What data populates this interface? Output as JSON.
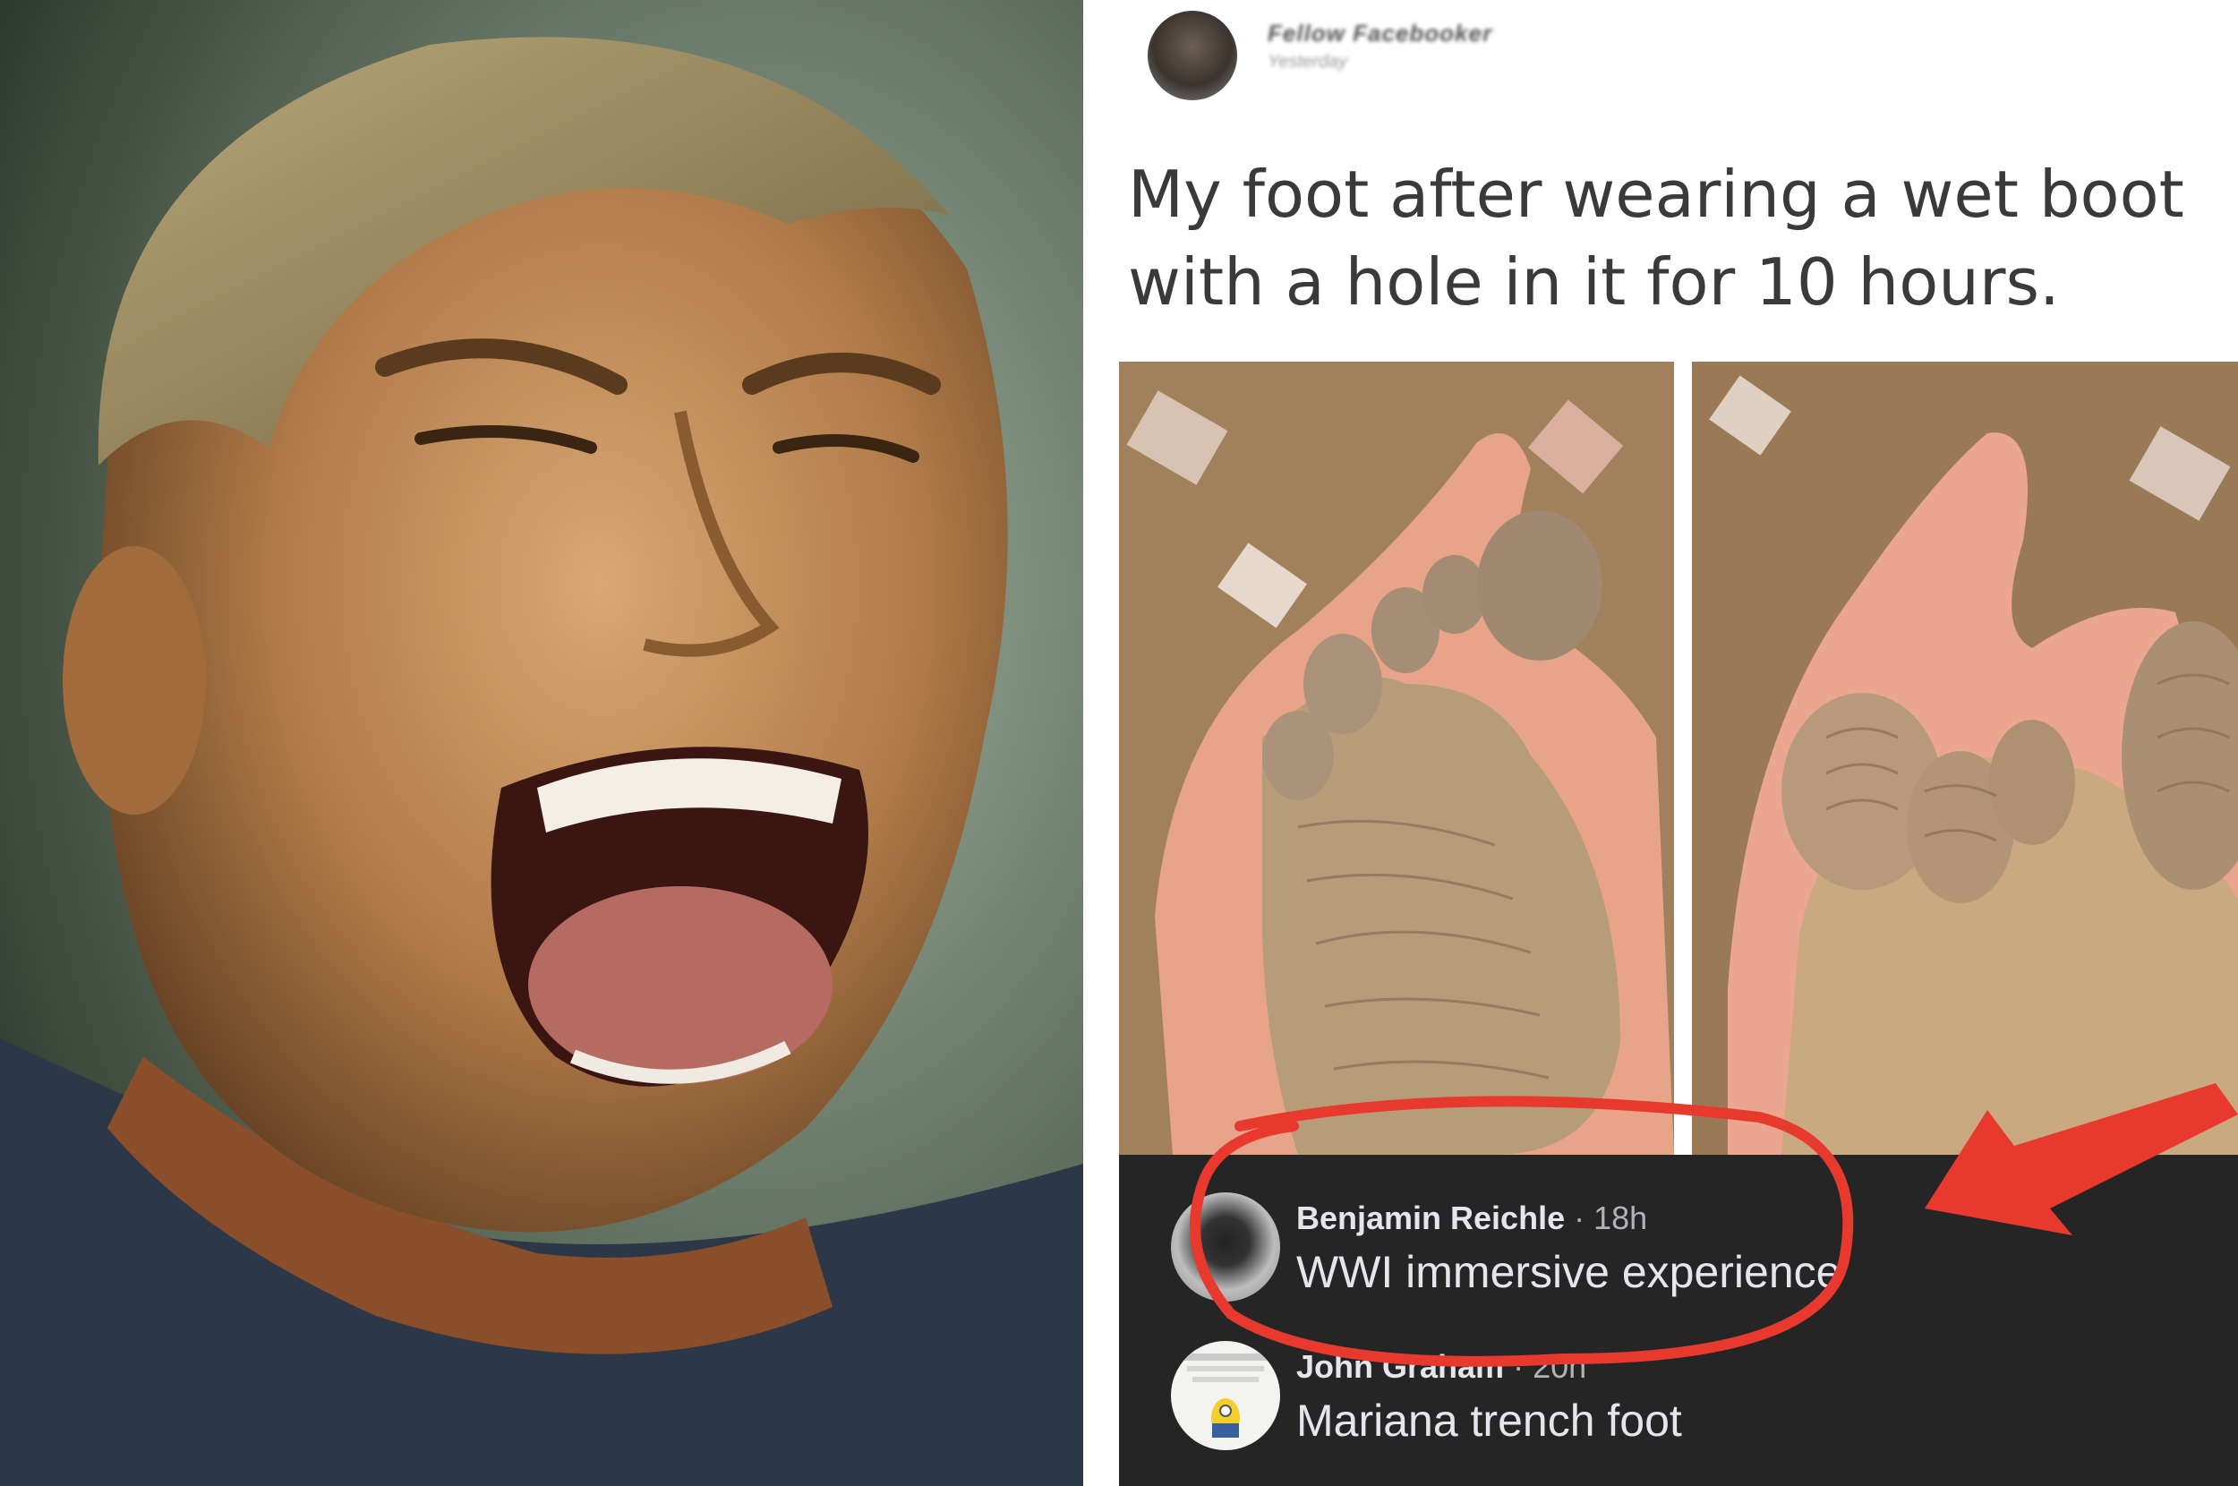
{
  "left_image": {
    "description_icon": "laughing-man-photo"
  },
  "post": {
    "author_name": "Fellow Facebooker",
    "author_meta": "Yesterday",
    "text": "My foot after wearing a wet boot\nwith a hole in it for 10 hours.",
    "photos": [
      "foot-photo-1",
      "foot-photo-2"
    ]
  },
  "comments": [
    {
      "name": "Benjamin Reichle",
      "time": "· 18h",
      "text": "WWI immersive experience"
    },
    {
      "name": "John Graham",
      "time": "· 20h",
      "text": "Mariana trench foot"
    }
  ],
  "annotation": {
    "ring_color": "#e8392f",
    "arrow_color": "#e8392f"
  }
}
